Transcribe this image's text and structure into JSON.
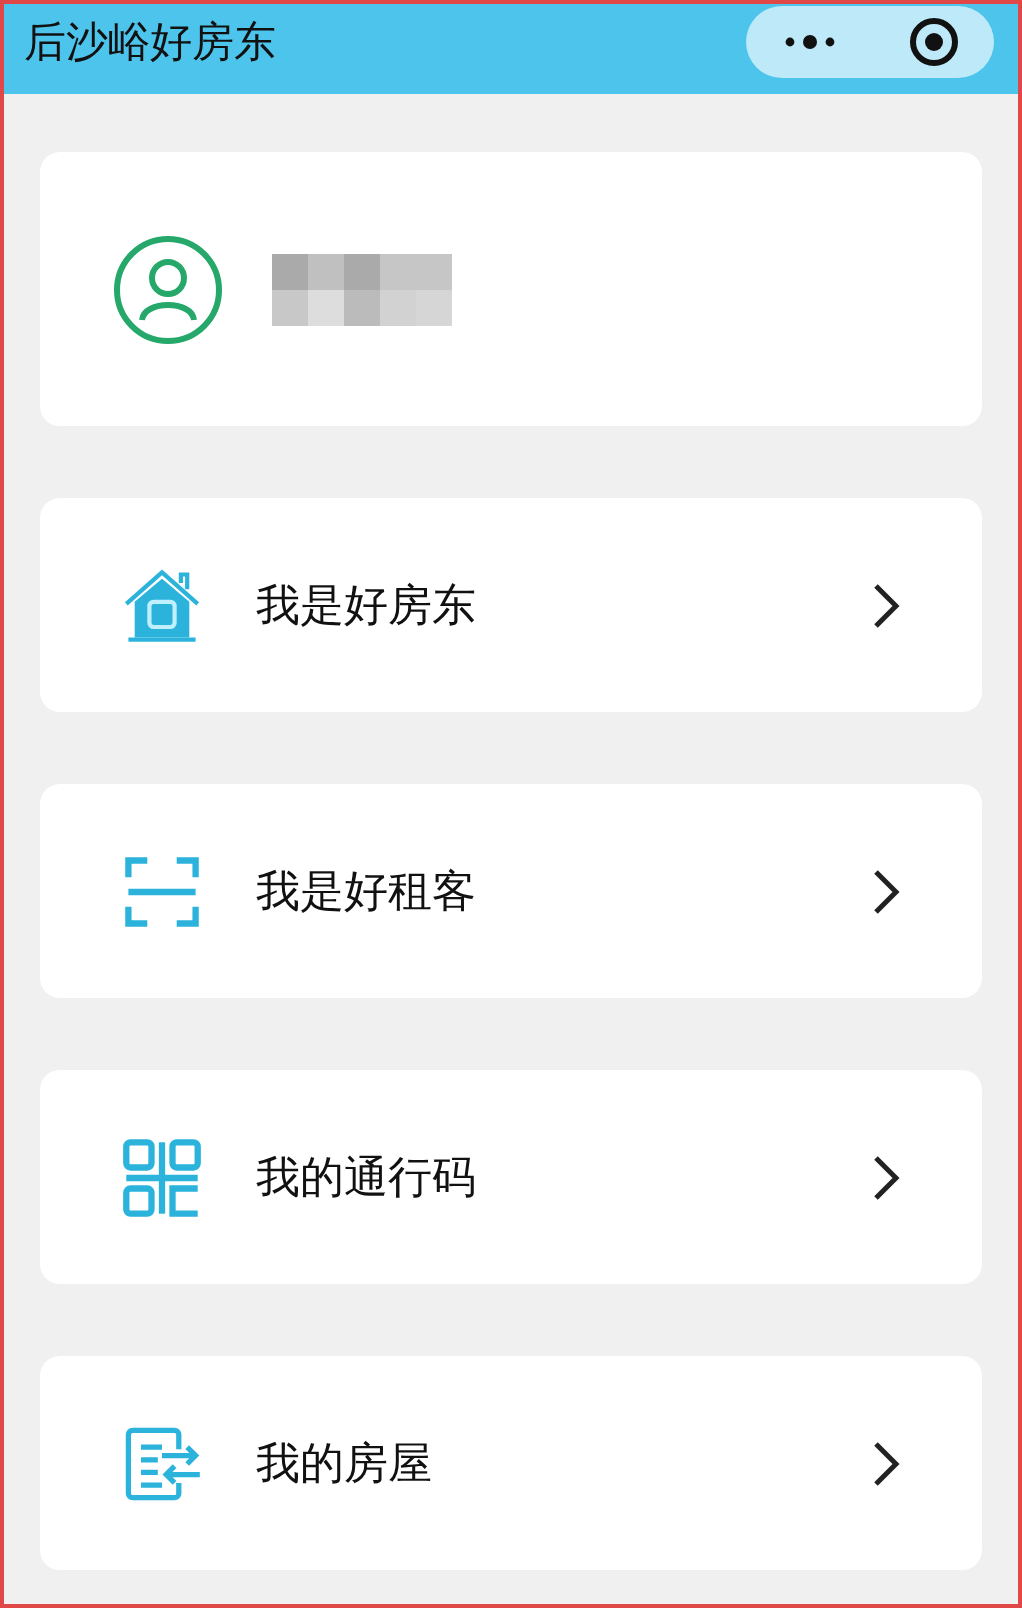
{
  "window": {
    "title": "后沙峪好房东"
  },
  "menu": [
    {
      "kind": "house",
      "label": "我是好房东"
    },
    {
      "kind": "scan",
      "label": "我是好租客"
    },
    {
      "kind": "qr",
      "label": "我的通行码"
    },
    {
      "kind": "transfer",
      "label": "我的房屋"
    }
  ]
}
